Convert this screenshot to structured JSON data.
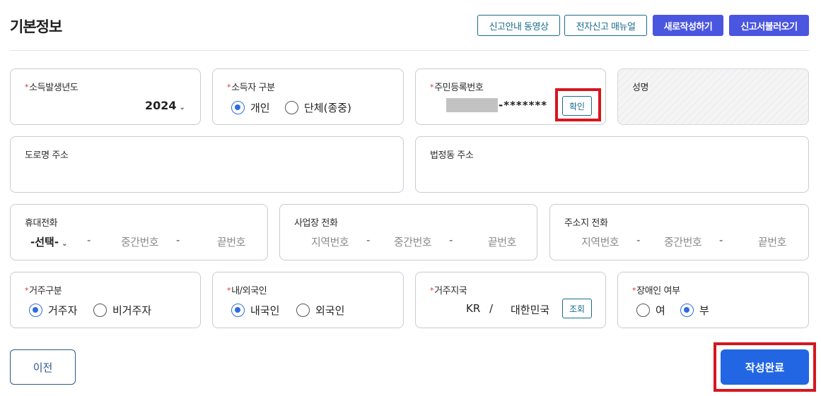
{
  "header": {
    "title": "기본정보",
    "buttons": {
      "video_guide": "신고안내 동영상",
      "manual": "전자신고 매뉴얼",
      "new": "새로작성하기",
      "load": "신고서불러오기"
    }
  },
  "required_mark": "*",
  "fields": {
    "income_year": {
      "label": "소득발생년도",
      "value": "2024"
    },
    "income_type": {
      "label": "소득자 구분",
      "options": [
        "개인",
        "단체(종중)"
      ],
      "selected": "개인"
    },
    "resident_no": {
      "label": "주민등록번호",
      "masked_suffix": "-*******",
      "confirm_label": "확인"
    },
    "name": {
      "label": "성명",
      "value": ""
    },
    "road_address": {
      "label": "도로명 주소",
      "value": ""
    },
    "legal_address": {
      "label": "법정동 주소",
      "value": ""
    },
    "mobile_phone": {
      "label": "휴대전화",
      "select_value": "-선택-",
      "middle_placeholder": "중간번호",
      "last_placeholder": "끝번호",
      "separator": "-"
    },
    "work_phone": {
      "label": "사업장 전화",
      "area_placeholder": "지역번호",
      "middle_placeholder": "중간번호",
      "last_placeholder": "끝번호",
      "separator": "-"
    },
    "home_phone": {
      "label": "주소지 전화",
      "area_placeholder": "지역번호",
      "middle_placeholder": "중간번호",
      "last_placeholder": "끝번호",
      "separator": "-"
    },
    "residency": {
      "label": "거주구분",
      "options": [
        "거주자",
        "비거주자"
      ],
      "selected": "거주자"
    },
    "nationality": {
      "label": "내/외국인",
      "options": [
        "내국인",
        "외국인"
      ],
      "selected": "내국인"
    },
    "residence_country": {
      "label": "거주지국",
      "code": "KR",
      "separator": "/",
      "name": "대한민국",
      "lookup_label": "조회"
    },
    "disability": {
      "label": "장애인 여부",
      "options": [
        "여",
        "부"
      ],
      "selected": "부"
    }
  },
  "footer": {
    "prev_label": "이전",
    "complete_label": "작성완료"
  },
  "colors": {
    "accent": "#2266e3",
    "primary_fill": "#4a55e0",
    "outline": "#1a6b8a",
    "highlight": "#d6161f",
    "required": "#e0342a"
  }
}
